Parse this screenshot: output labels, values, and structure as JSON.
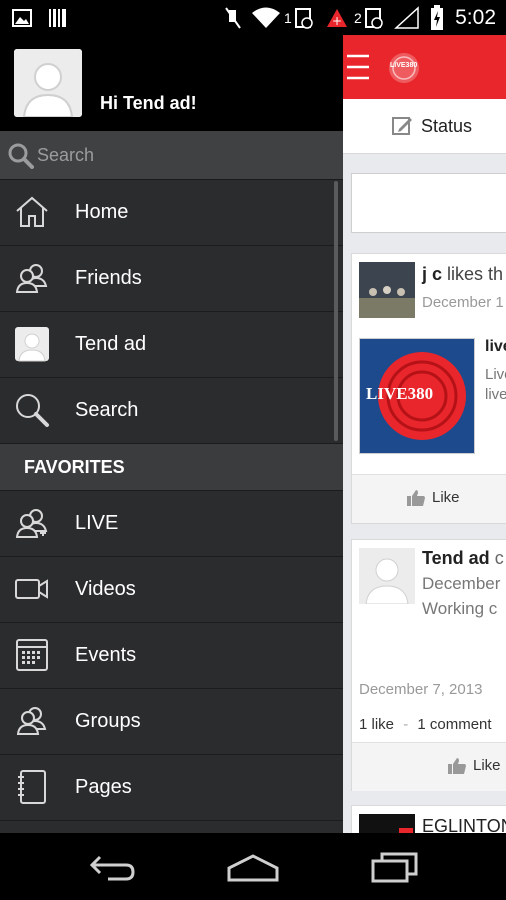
{
  "status_bar": {
    "time": "5:02",
    "badge_1": "1",
    "badge_2": "2"
  },
  "drawer": {
    "greeting": "Hi Tend ad!",
    "search_placeholder": "Search",
    "items": [
      {
        "label": "Home",
        "icon": "home-icon"
      },
      {
        "label": "Friends",
        "icon": "friends-icon"
      },
      {
        "label": "Tend ad",
        "icon": "avatar-icon"
      },
      {
        "label": "Search",
        "icon": "search-icon"
      }
    ],
    "favorites_header": "FAVORITES",
    "favorites": [
      {
        "label": "LIVE",
        "icon": "group-icon"
      },
      {
        "label": "Videos",
        "icon": "video-camera-icon"
      },
      {
        "label": "Events",
        "icon": "calendar-icon"
      },
      {
        "label": "Groups",
        "icon": "groups-icon"
      },
      {
        "label": "Pages",
        "icon": "notebook-icon"
      }
    ]
  },
  "main": {
    "status_label": "Status",
    "post1": {
      "author": "j c",
      "action": "likes th",
      "date": "December 1",
      "link_title": "live",
      "link_line1": "Live",
      "link_line2": "live",
      "logo_text": "LIVE380",
      "like_label": "Like"
    },
    "post2": {
      "author": "Tend ad",
      "author_suffix": "c",
      "date": "December",
      "text": "Working c",
      "timestamp": "December 7, 2013",
      "likes": "1 like",
      "separator": "-",
      "comments": "1 comment",
      "like_label": "Like"
    },
    "post3": {
      "author": "EGLINTON"
    },
    "brand_badge": "LIVE380"
  },
  "colors": {
    "accent": "#e8262b",
    "drawer_bg": "#2b2c2e"
  }
}
